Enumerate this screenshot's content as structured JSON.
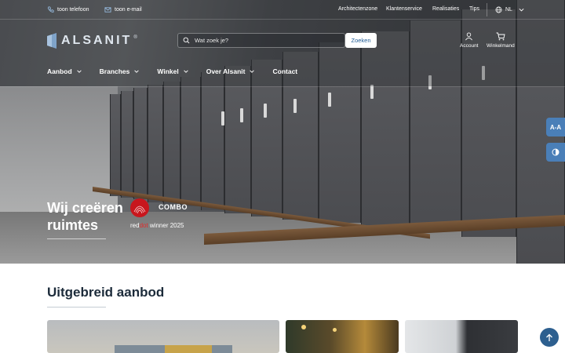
{
  "topbar": {
    "phone_label": "toon telefoon",
    "email_label": "toon e-mail",
    "links": [
      "Architectenzone",
      "Klantenservice",
      "Realisaties",
      "Tips"
    ],
    "language": "NL"
  },
  "header": {
    "logo_text": "ALSANIT",
    "search_placeholder": "Wat zoek je?",
    "search_button": "Zoeken",
    "account_label": "Account",
    "cart_label": "Winkelmand"
  },
  "nav": {
    "items": [
      {
        "label": "Aanbod",
        "has_dropdown": true
      },
      {
        "label": "Branches",
        "has_dropdown": true
      },
      {
        "label": "Winkel",
        "has_dropdown": true
      },
      {
        "label": "Over Alsanit",
        "has_dropdown": true
      },
      {
        "label": "Contact",
        "has_dropdown": false
      }
    ]
  },
  "hero": {
    "title": "Wij creëren ruimtes",
    "award_name": "COMBO",
    "award_red": "red",
    "award_dot": "dot",
    "award_suffix": " winner 2025"
  },
  "accessibility": {
    "font_size_label": "A-A",
    "contrast_icon": "contrast-icon"
  },
  "section": {
    "title": "Uitgebreid aanbod"
  },
  "colors": {
    "brand_blue": "#2d5f8f",
    "accent_red": "#c8161d",
    "side_tab": "#4a7fb8"
  }
}
